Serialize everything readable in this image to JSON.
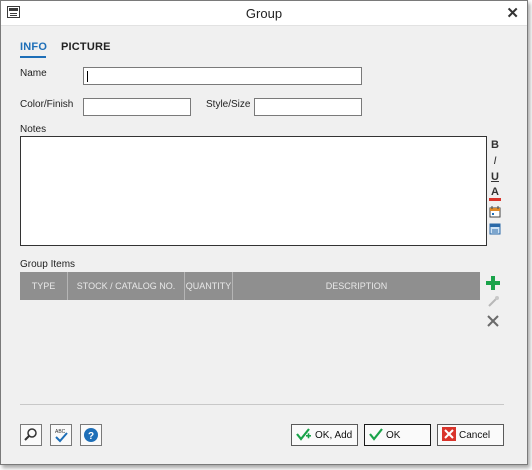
{
  "window": {
    "title": "Group"
  },
  "tabs": [
    {
      "label": "INFO"
    },
    {
      "label": "PICTURE"
    }
  ],
  "form": {
    "name_label": "Name",
    "name_value": "",
    "color_label": "Color/Finish",
    "color_value": "",
    "style_label": "Style/Size",
    "style_value": "",
    "notes_label": "Notes",
    "notes_value": ""
  },
  "format_toolbar": {
    "bold": "B",
    "italic": "I",
    "underline": "U",
    "font_color": "A"
  },
  "group_items": {
    "label": "Group Items",
    "columns": [
      "TYPE",
      "STOCK / CATALOG NO.",
      "QUANTITY",
      "DESCRIPTION"
    ],
    "rows": []
  },
  "footer": {
    "ok_add_label": "OK, Add",
    "ok_label": "OK",
    "cancel_label": "Cancel"
  },
  "colors": {
    "accent": "#1e6fb8",
    "grid_header": "#8f8f8f",
    "add_green": "#1aa34a",
    "cancel_red": "#d9342b"
  }
}
